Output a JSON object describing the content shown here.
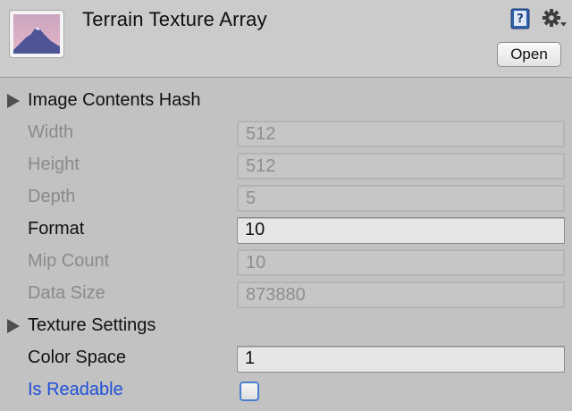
{
  "header": {
    "title": "Terrain Texture Array",
    "open_label": "Open",
    "icons": [
      "texture-thumbnail-icon",
      "help-book-icon",
      "gear-icon"
    ]
  },
  "sections": {
    "image_contents_hash": "Image Contents Hash",
    "texture_settings": "Texture Settings"
  },
  "properties": {
    "width": {
      "label": "Width",
      "value": "512"
    },
    "height": {
      "label": "Height",
      "value": "512"
    },
    "depth": {
      "label": "Depth",
      "value": "5"
    },
    "format": {
      "label": "Format",
      "value": "10"
    },
    "mip_count": {
      "label": "Mip Count",
      "value": "10"
    },
    "data_size": {
      "label": "Data Size",
      "value": "873880"
    },
    "color_space": {
      "label": "Color Space",
      "value": "1"
    },
    "is_readable": {
      "label": "Is Readable",
      "checked": false
    }
  }
}
